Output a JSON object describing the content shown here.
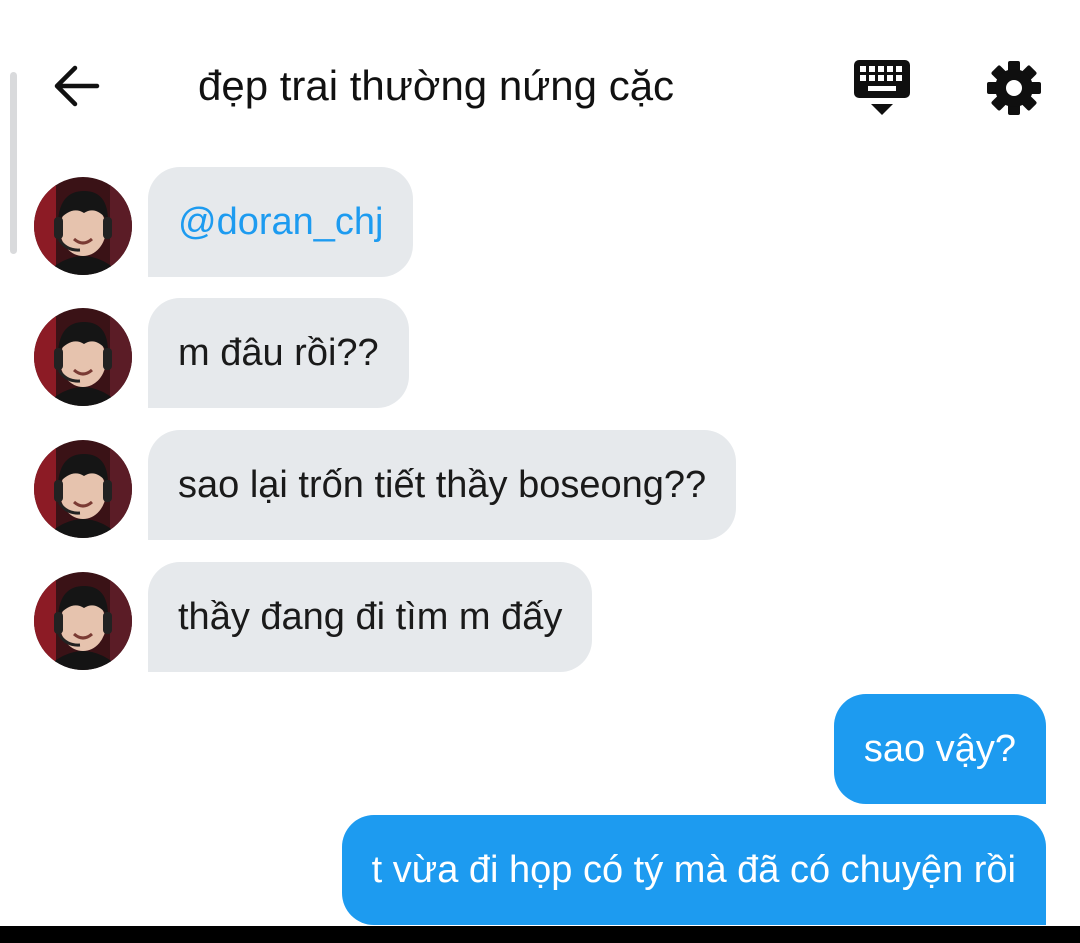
{
  "header": {
    "title": "đẹp trai thường nứng cặc",
    "back_icon": "arrow-left-icon",
    "keyboard_icon": "keyboard-hide-icon",
    "settings_icon": "gear-icon"
  },
  "colors": {
    "incoming_bubble": "#e6e9ec",
    "outgoing_bubble": "#1d9bf0",
    "mention": "#1d9bf0"
  },
  "messages": [
    {
      "direction": "incoming",
      "text": "@doran_chj",
      "is_mention": true
    },
    {
      "direction": "incoming",
      "text": "m đâu rồi??"
    },
    {
      "direction": "incoming",
      "text": "sao lại trốn tiết thầy boseong??"
    },
    {
      "direction": "incoming",
      "text": "thầy đang đi tìm m đấy"
    },
    {
      "direction": "outgoing",
      "text": "sao vậy?"
    },
    {
      "direction": "outgoing",
      "text": "t vừa đi họp có tý mà đã có chuyện rồi"
    }
  ]
}
